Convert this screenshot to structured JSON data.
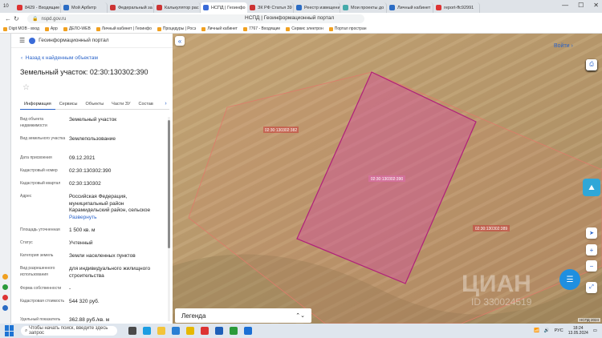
{
  "browser": {
    "tab_count": "10",
    "tabs": [
      {
        "label": "8429 - Входящие",
        "color": "#d33"
      },
      {
        "label": "Мой Арбитр",
        "color": "#2b6cc4"
      },
      {
        "label": "Федеральный за",
        "color": "#c33"
      },
      {
        "label": "Калькулятор рас",
        "color": "#c33"
      },
      {
        "label": "НСПД | Геоинфо",
        "color": "#3a6bd8"
      },
      {
        "label": "ЗК РФ Статья 39",
        "color": "#c33"
      },
      {
        "label": "Реестр извещени",
        "color": "#2b6cc4"
      },
      {
        "label": "Мои проекты до",
        "color": "#4aa"
      },
      {
        "label": "Личный кабинет",
        "color": "#2b6cc4"
      },
      {
        "label": "report-ffc92991",
        "color": "#d33"
      }
    ],
    "active_tab": 4,
    "url": "nspd.gov.ru",
    "page_title": "НСПД | Геоинформационный портал",
    "bookmarks": [
      "Digit МОВ - вход",
      "App",
      "ДЕЛО-WEB",
      "Личный кабинет | Геоинфо",
      "Процедуры | Росэ",
      "Личный кабинет",
      "7767 - Входящие",
      "Сервис электрон",
      "Портал простран"
    ]
  },
  "panel": {
    "header": "Геоинформационный портал",
    "back_link": "Назад к найденным объектам",
    "title": "Земельный участок: 02:30:130302:390",
    "tabs": [
      "Информация",
      "Сервисы",
      "Объекты",
      "Части ЗУ",
      "Состав"
    ],
    "rows": [
      {
        "label": "Вид объекта недвижимости",
        "value": "Земельный участок"
      },
      {
        "label": "Вид земельного участка",
        "value": "Землепользование"
      },
      {
        "label": "Дата присвоения",
        "value": "09.12.2021"
      },
      {
        "label": "Кадастровый номер",
        "value": "02:30:130302:390"
      },
      {
        "label": "Кадастровый квартал",
        "value": "02:30:130302"
      },
      {
        "label": "Адрес",
        "value": "Российская Федерация, муниципальный район Карамидельский район, сельское",
        "link": "Развернуть"
      },
      {
        "label": "Площадь уточненная",
        "value": "1 500 кв. м"
      },
      {
        "label": "Статус",
        "value": "Учтенный"
      },
      {
        "label": "Категория земель",
        "value": "Земли населенных пунктов"
      },
      {
        "label": "Вид разрешенного использования",
        "value": "для индивидуального жилищного строительства"
      },
      {
        "label": "Форма собственности",
        "value": "-"
      },
      {
        "label": "Кадастровая стоимость",
        "value": "544 320 руб."
      },
      {
        "label": "Удельный показатель",
        "value": "362.88 руб./кв. м"
      }
    ]
  },
  "map": {
    "login_label": "Войти",
    "legend_label": "Легенда",
    "parcel_label_main": "02:30:130302:390",
    "parcel_label_left": "02:30:130302:382",
    "parcel_label_right": "02:30:130302:389",
    "watermark": "ЦИАН",
    "watermark_id": "ID 330024519",
    "attribution": "НСПД 2024"
  },
  "taskbar": {
    "search_placeholder": "Чтобы начать поиск, введите здесь запрос",
    "language": "РУС",
    "time": "18:24",
    "date": "13.05.2024"
  }
}
